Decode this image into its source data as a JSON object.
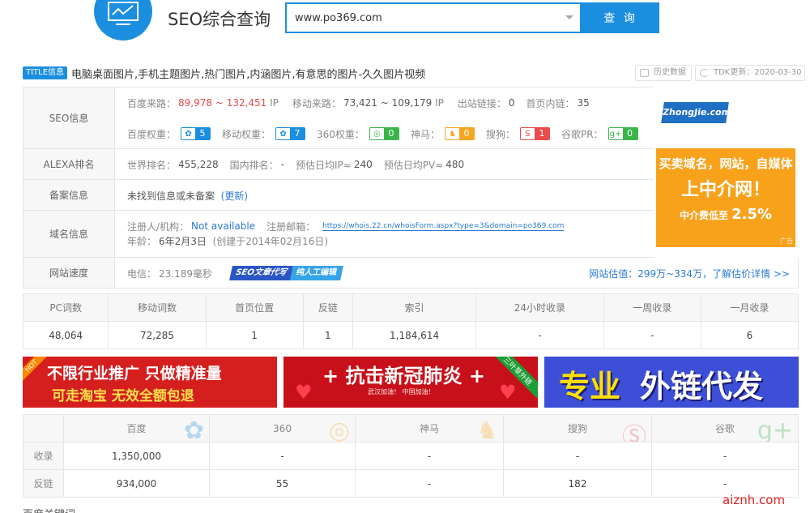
{
  "header": {
    "title": "SEO综合查询",
    "search_value": "www.po369.com",
    "search_button": "查 询"
  },
  "title_row": {
    "tag": "TITLE信息",
    "text": "电脑桌面图片,手机主题图片,热门图片,内涵图片,有意思的图片-久久图片视频",
    "history_btn": "历史数据",
    "tdk_btn": "TDK更新：2020-03-30"
  },
  "seo": {
    "label": "SEO信息",
    "baidu_src_label": "百度来路：",
    "baidu_src_value": "89,978 ~ 132,451",
    "ip": "IP",
    "mobile_src_label": "移动来路：",
    "mobile_src_value": "73,421 ~ 109,179",
    "outlinks_label": "出站链接：",
    "outlinks_value": "0",
    "inner_links_label": "首页内链：",
    "inner_links_value": "35",
    "baidu_weight_label": "百度权重：",
    "baidu_weight": "5",
    "mobile_weight_label": "移动权重：",
    "mobile_weight": "7",
    "w360_label": "360权重：",
    "w360": "0",
    "shenma_label": "神马：",
    "shenma": "0",
    "sogou_label": "搜狗：",
    "sogou": "1",
    "google_label": "谷歌PR：",
    "google": "0"
  },
  "alexa": {
    "label": "ALEXA排名",
    "world_label": "世界排名：",
    "world": "455,228",
    "cn_label": "国内排名：",
    "cn": "-",
    "ip_label": "预估日均IP≈",
    "ip": "240",
    "pv_label": "预估日均PV≈",
    "pv": "480"
  },
  "beian": {
    "label": "备案信息",
    "text": "未找到信息或未备案",
    "update": "(更新)"
  },
  "domain": {
    "label": "域名信息",
    "registrant_label": "注册人/机构：",
    "registrant": "Not available",
    "email_label": "注册邮箱：",
    "whois_link": "https://whois.22.cn/whoisForm.aspx?type=3&domain=po369.com",
    "age_label": "年龄：",
    "age": "6年2月3日",
    "created": "(创建于2014年02月16日)"
  },
  "speed": {
    "label": "网站速度",
    "telecom_label": "电信：",
    "telecom": "23.189毫秒",
    "promo_a": "SEO文章代写",
    "promo_b": "纯人工编辑",
    "estimate": "网站估值：299万~334万，了解估价详情 >>"
  },
  "ad_right": {
    "logo": "ZhongJie.com",
    "line1": "买卖域名，网站，自媒体",
    "line2": "上中介网！",
    "line3": "中介费低至",
    "line3_big": "2.5%",
    "tag": "广告"
  },
  "stats": {
    "headers": [
      "PC词数",
      "移动词数",
      "首页位置",
      "反链",
      "索引",
      "24小时收录",
      "一周收录",
      "一月收录"
    ],
    "values": [
      "48,064",
      "72,285",
      "1",
      "1",
      "1,184,614",
      "-",
      "-",
      "6"
    ]
  },
  "banners": {
    "b1_hot": "HOT",
    "b1_line1": "不限行业推广 只做精准量",
    "b1_line2": "可走淘宝    无效全额包退",
    "b2_line1": "+ 抗击新冠肺炎 +",
    "b2_line2": "武汉加油！ 中国加油！",
    "b2_ribbon": "三叶草外链",
    "b3_word1": "专业",
    "b3_word2": "外链代发",
    "ad": "广告"
  },
  "engines": {
    "headers": [
      "",
      "百度",
      "360",
      "神马",
      "搜狗",
      "谷歌"
    ],
    "rows": [
      {
        "label": "收录",
        "values": [
          "1,350,000",
          "-",
          "-",
          "-",
          "-"
        ]
      },
      {
        "label": "反链",
        "values": [
          "934,000",
          "55",
          "-",
          "182",
          "-"
        ]
      }
    ]
  },
  "bottom_label": "百度关键词",
  "watermark": "aiznh.com"
}
